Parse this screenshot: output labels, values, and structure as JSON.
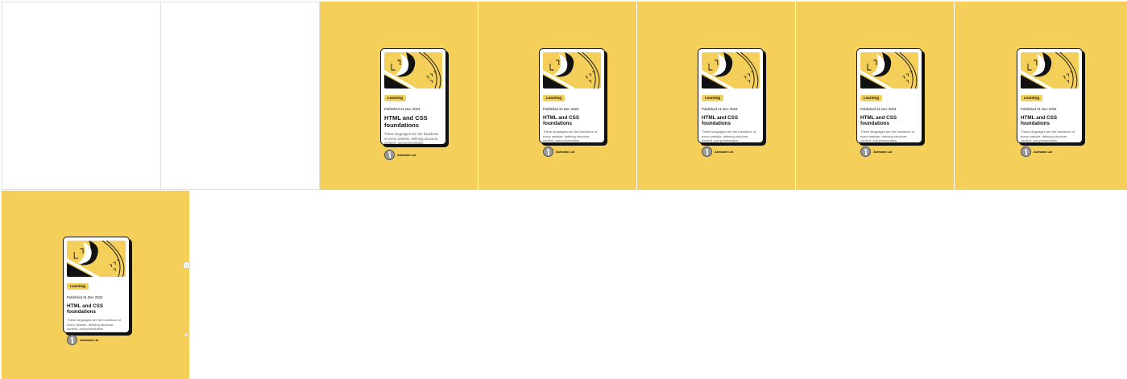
{
  "cards": {
    "tag": "Learning",
    "published": "Published 21 Dec 2023",
    "title": "HTML and CSS foundations",
    "description": "These languages are the backbone of every website, defining structure, content, and presentation.",
    "author": "Ashwani Lal"
  },
  "colors": {
    "accent": "#f4d05a",
    "card_bg": "#ffffff",
    "ink": "#111111",
    "muted": "#555555"
  },
  "icons": {
    "resize_handle": "resize-handle-icon"
  }
}
